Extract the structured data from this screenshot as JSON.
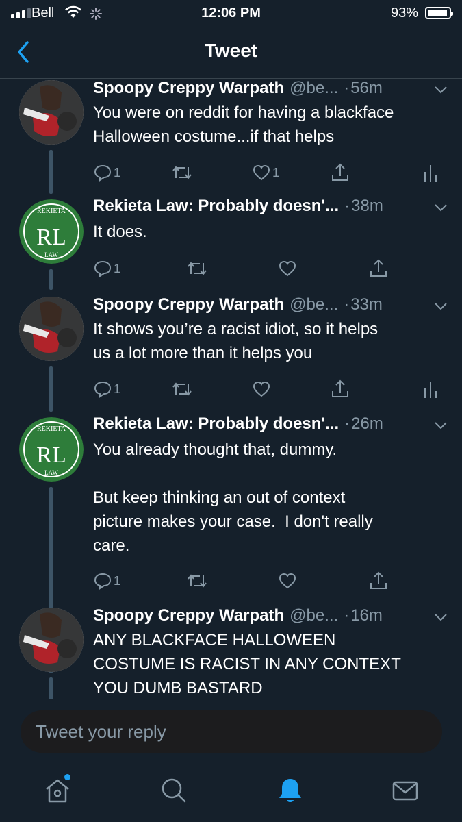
{
  "status_bar": {
    "carrier": "Bell",
    "time": "12:06 PM",
    "battery": "93%",
    "battery_level": 0.93,
    "signal_bars": 3
  },
  "header": {
    "title": "Tweet",
    "back_icon": "chevron-left-icon"
  },
  "tweets": [
    {
      "name": "Spoopy Creppy Warpath",
      "handle": "@be...",
      "time": "56m",
      "text": "You were on reddit for having a blackface\nHalloween costume...if that helps",
      "replies": "1",
      "retweets": "",
      "likes": "1",
      "avatar": "comic-hero-avatar",
      "has_analytics": true
    },
    {
      "name": "Rekieta Law: Probably doesn'...",
      "handle": "",
      "time": "38m",
      "text": "It does.",
      "replies": "1",
      "retweets": "",
      "likes": "",
      "avatar": "rekieta-law-logo",
      "has_analytics": false
    },
    {
      "name": "Spoopy Creppy Warpath",
      "handle": "@be...",
      "time": "33m",
      "text": "It shows you’re a racist idiot, so it helps\nus a lot more than it helps you",
      "replies": "1",
      "retweets": "",
      "likes": "",
      "avatar": "comic-hero-avatar",
      "has_analytics": true
    },
    {
      "name": "Rekieta Law: Probably doesn'...",
      "handle": "",
      "time": "26m",
      "text": "You already thought that, dummy.\n\nBut keep thinking an out of context\npicture makes your case.  I don't really\ncare.",
      "replies": "1",
      "retweets": "",
      "likes": "",
      "avatar": "rekieta-law-logo",
      "has_analytics": false
    },
    {
      "name": "Spoopy Creppy Warpath",
      "handle": "@be...",
      "time": "16m",
      "text": "ANY BLACKFACE HALLOWEEN\nCOSTUME IS RACIST IN ANY CONTEXT\nYOU DUMB BASTARD",
      "replies": "",
      "retweets": "",
      "likes": "",
      "avatar": "comic-hero-avatar",
      "has_analytics": false
    }
  ],
  "logo": {
    "top_text": "REKIETA",
    "letters": "RL",
    "bottom_text": "LAW"
  },
  "reply": {
    "placeholder": "Tweet your reply"
  },
  "tab_bar": [
    "home-icon",
    "search-icon",
    "notifications-icon",
    "messages-icon"
  ],
  "colors": {
    "background": "#15202b",
    "accent": "#1da1f2",
    "muted": "#8899a6",
    "logo_green": "#2e7d3a"
  }
}
